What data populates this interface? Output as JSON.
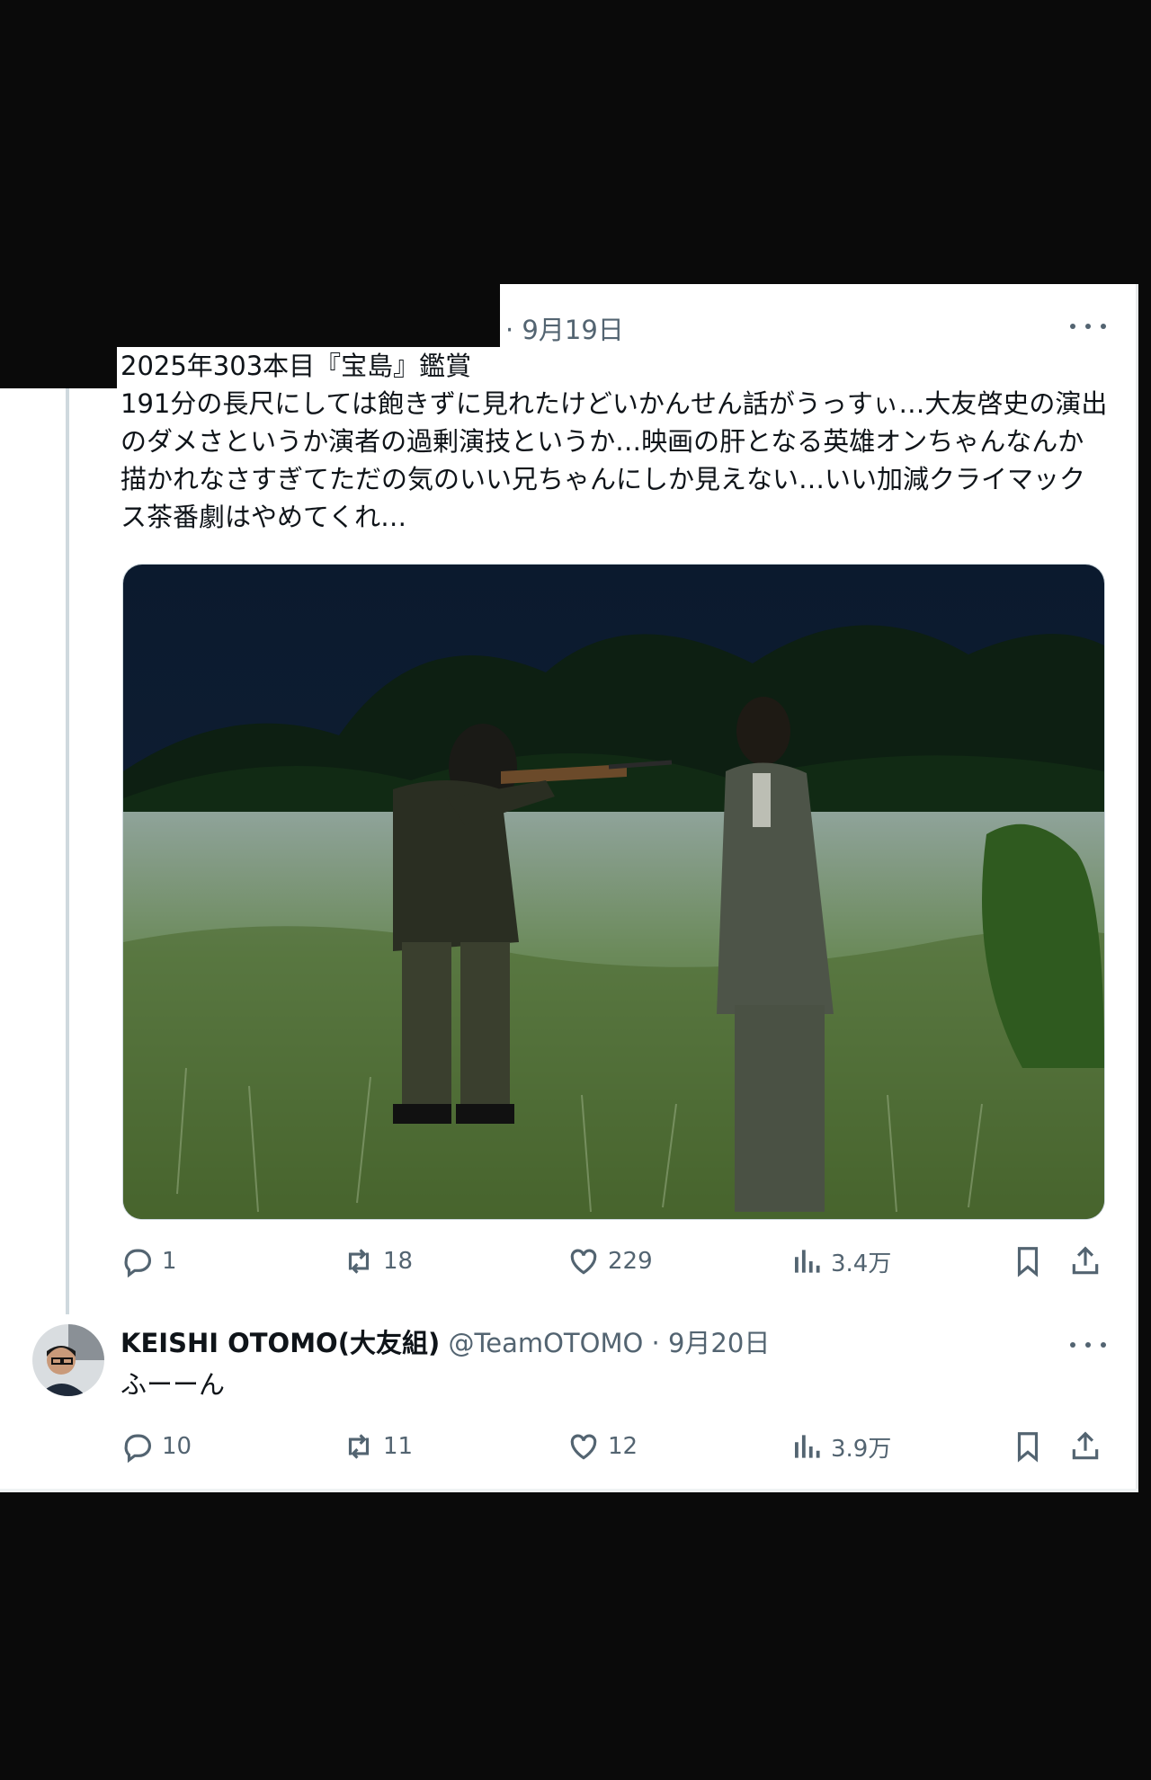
{
  "tweet1": {
    "date": "· 9月19日",
    "text": "2025年303本目『宝島』鑑賞\n191分の長尺にしては飽きずに見れたけどいかんせん話がうっすぃ…大友啓史の演出のダメさというか演者の過剰演技というか…映画の肝となる英雄オンちゃんなんか描かれなさすぎてただの気のいい兄ちゃんにしか見えない…いい加減クライマックス茶番劇はやめてくれ…",
    "stats": {
      "replies": "1",
      "reposts": "18",
      "likes": "229",
      "views": "3.4万"
    }
  },
  "reply": {
    "name": "KEISHI OTOMO(大友組)",
    "handle": "@TeamOTOMO · 9月20日",
    "text": "ふーーん",
    "stats": {
      "replies": "10",
      "reposts": "11",
      "likes": "12",
      "views": "3.9万"
    }
  },
  "icons": [
    "reply-icon",
    "repost-icon",
    "like-icon",
    "views-icon",
    "bookmark-icon",
    "share-icon",
    "more-icon"
  ],
  "colors": {
    "text": "#0f1419",
    "secondary": "#536471",
    "background": "#ffffff",
    "outside": "#0a0a0a"
  }
}
